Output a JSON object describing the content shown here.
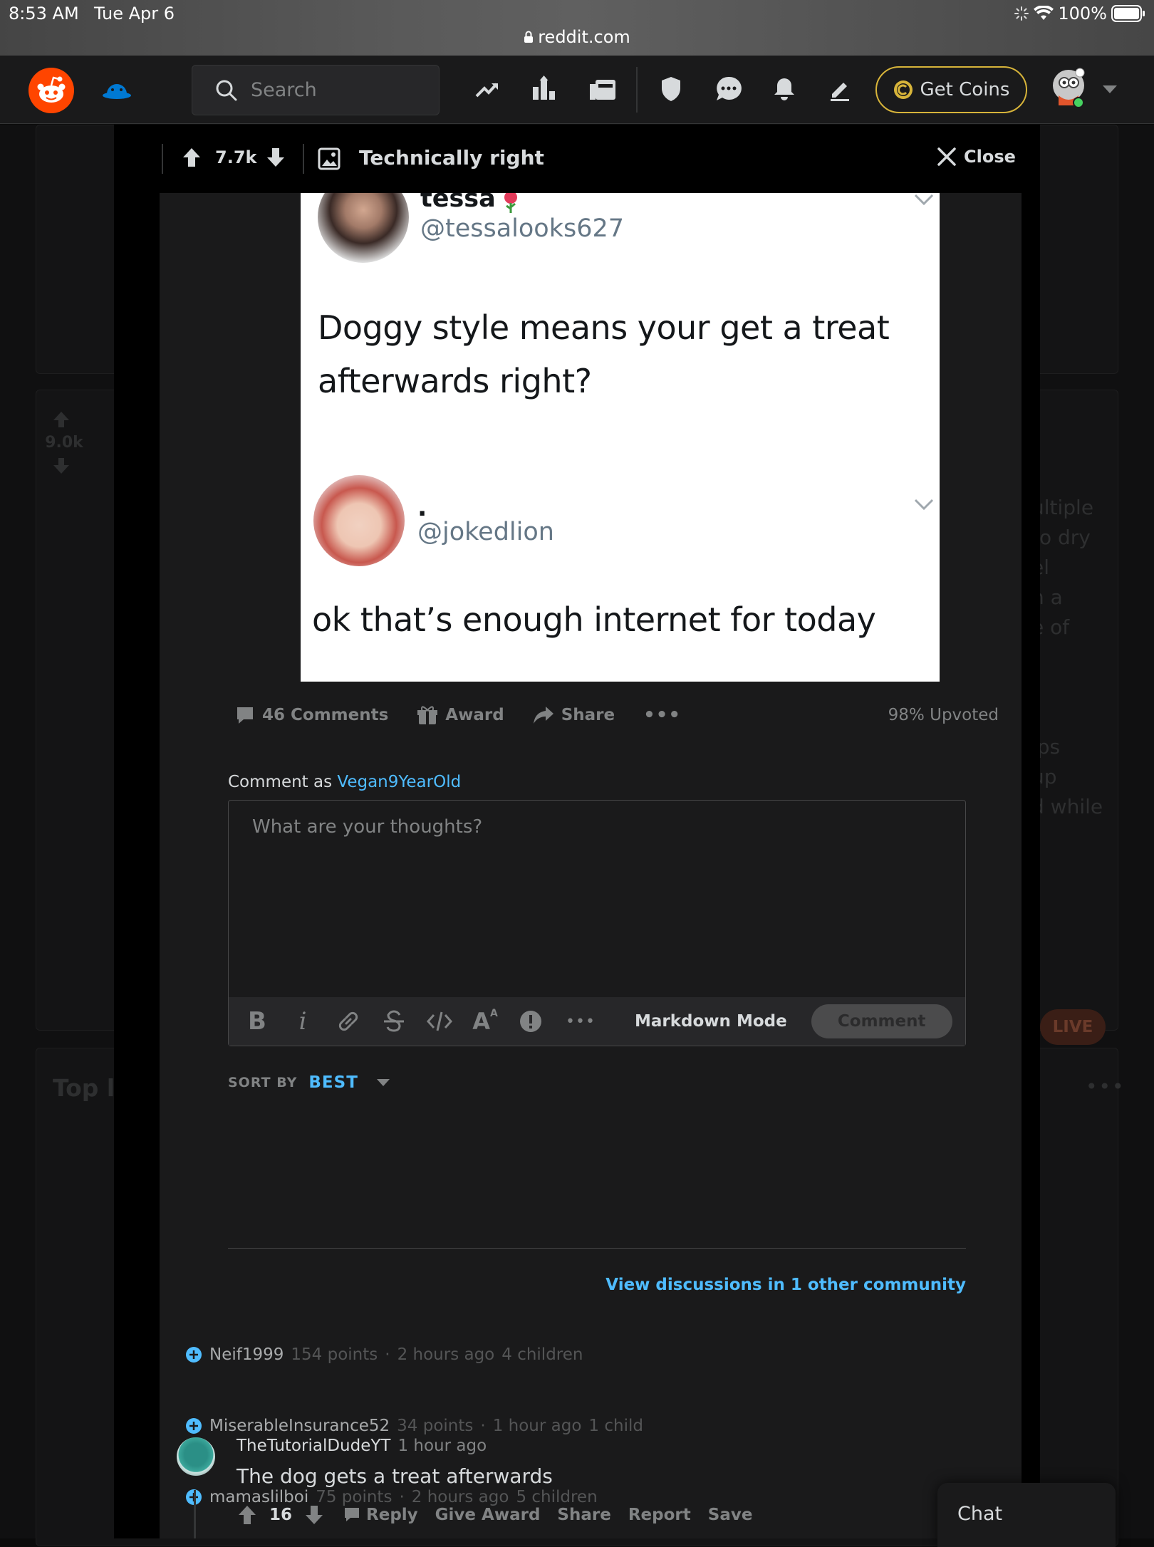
{
  "status_bar": {
    "time": "8:53 AM",
    "date": "Tue Apr 6",
    "battery": "100%",
    "url": "reddit.com"
  },
  "header": {
    "search_placeholder": "Search",
    "get_coins": "Get Coins"
  },
  "background": {
    "score": "9.0k",
    "widget_title": "Top li",
    "live_badge": "LIVE",
    "side_text": [
      "ultiple",
      "to dry",
      "el",
      "n a",
      "e of",
      "ips",
      "up",
      "d while"
    ]
  },
  "post": {
    "score": "7.7k",
    "title": "Technically right",
    "close_label": "Close",
    "tweet1": {
      "name": "tessa",
      "handle": "@tessalooks627",
      "text_line1": "Doggy style means your get a treat",
      "text_line2": "afterwards right?"
    },
    "tweet2": {
      "name": ".",
      "handle": "@jokedlion",
      "text": "ok that’s enough internet for today"
    },
    "comments_label": "46 Comments",
    "award_label": "Award",
    "share_label": "Share",
    "upvoted": "98% Upvoted"
  },
  "comment_box": {
    "comment_as_prefix": "Comment as",
    "username": "Vegan9YearOld",
    "placeholder": "What are your thoughts?",
    "markdown_mode": "Markdown Mode",
    "submit": "Comment"
  },
  "sort": {
    "label": "SORT BY",
    "value": "BEST"
  },
  "other_community": "View discussions in 1 other community",
  "collapsed_comments": [
    {
      "user": "Neif1999",
      "points": "154 points",
      "time": "2 hours ago",
      "children": "4 children"
    },
    {
      "user": "MiserableInsurance52",
      "points": "34 points",
      "time": "1 hour ago",
      "children": "1 child"
    },
    {
      "user": "mamaslilboi",
      "points": "75 points",
      "time": "2 hours ago",
      "children": "5 children"
    }
  ],
  "comment": {
    "user": "TheTutorialDudeYT",
    "time": "1 hour ago",
    "text": "The dog gets a treat afterwards",
    "score": "16",
    "actions": [
      "Reply",
      "Give Award",
      "Share",
      "Report",
      "Save"
    ]
  },
  "chat": {
    "label": "Chat"
  },
  "colors": {
    "accent_blue": "#4fbcff",
    "coins_border": "#d7b43a",
    "reddit_orange": "#ff4500",
    "live_red": "#5a2a1e"
  }
}
